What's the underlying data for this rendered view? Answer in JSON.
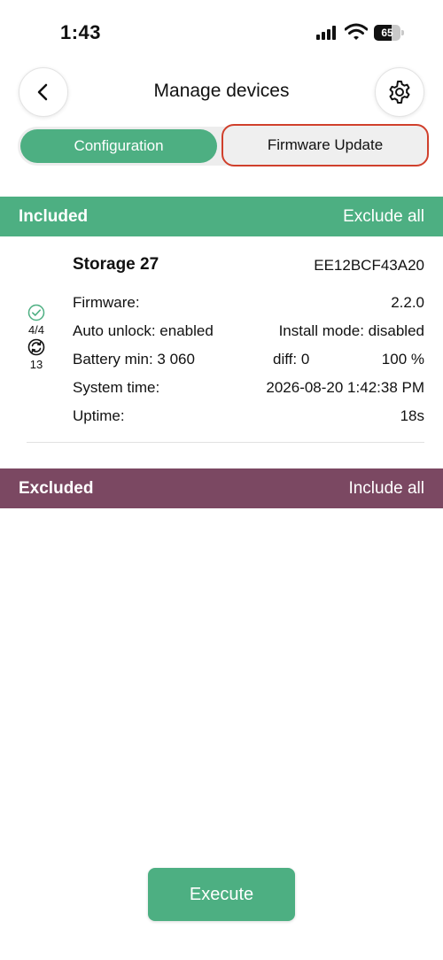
{
  "status_bar": {
    "time": "1:43",
    "battery_percent": "65",
    "battery_level": 0.65,
    "icons": [
      "signal-icon",
      "wifi-icon",
      "battery-icon"
    ]
  },
  "header": {
    "title": "Manage devices",
    "back_icon": "chevron-left-icon",
    "settings_icon": "gear-icon"
  },
  "tabs": {
    "configuration": "Configuration",
    "firmware_update": "Firmware Update",
    "selected": "Configuration",
    "highlighted": "Firmware Update"
  },
  "included": {
    "title": "Included",
    "action": "Exclude all",
    "devices": [
      {
        "name": "Storage 27",
        "id": "EE12BCF43A20",
        "status": {
          "check_icon": "check-circle-icon",
          "count": "4/4",
          "sync_icon": "sync-icon",
          "sync_count": "13"
        },
        "firmware_label": "Firmware:",
        "firmware_value": "2.2.0",
        "auto_unlock": "Auto unlock: enabled",
        "install_mode": "Install mode: disabled",
        "battery_min": "Battery min: 3 060",
        "diff": "diff: 0",
        "battery_percent": "100 %",
        "system_time_label": "System time:",
        "system_time_value": "2026-08-20 1:42:38 PM",
        "uptime_label": "Uptime:",
        "uptime_value": "18s"
      }
    ]
  },
  "excluded": {
    "title": "Excluded",
    "action": "Include all"
  },
  "execute_label": "Execute",
  "colors": {
    "accent_green": "#4daf82",
    "excluded_purple": "#7b4862",
    "highlight_red": "#d0402c"
  }
}
